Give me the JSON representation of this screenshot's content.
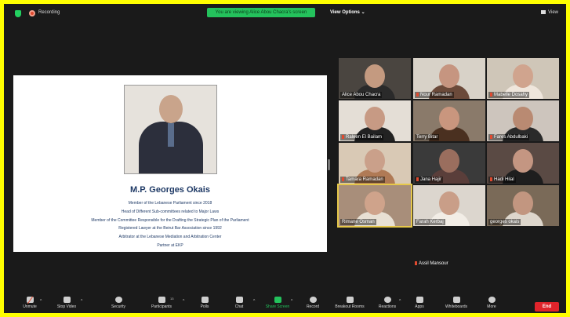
{
  "topbar": {
    "recording_label": "Recording",
    "viewing_banner": "You are viewing Alice Abou Chacra's screen",
    "view_options": "View Options ⌄",
    "view_label": "View"
  },
  "slide": {
    "title": "M.P. Georges Okais",
    "lines": [
      "Member of the Lebanese Parliament since 2018",
      "Head of Different Sub-committees related to Major Laws",
      "Member of the Committee Responsible for the Drafting the Strategic Plan of the Parliament",
      "Registered Lawyer at the Beirut Bar Association since 1992",
      "Arbitrator at the Lebanese Mediation and Arbitration Center",
      "Partner at EKP"
    ]
  },
  "participants": [
    {
      "name": "Alice Abou Chacra",
      "muted": false
    },
    {
      "name": "Nour Ramadan",
      "muted": true
    },
    {
      "name": "Mabelle Dosahy",
      "muted": true
    },
    {
      "name": "Raleen El Bailam",
      "muted": true
    },
    {
      "name": "Terry Bitar",
      "muted": false
    },
    {
      "name": "Fares Abdulbaki",
      "muted": true
    },
    {
      "name": "Tamara Ramadan",
      "muted": true
    },
    {
      "name": "Jana Hajir",
      "muted": true
    },
    {
      "name": "Hadi Hilal",
      "muted": true
    },
    {
      "name": "Rimane Osman",
      "muted": false
    },
    {
      "name": "Farah Kerbaj",
      "muted": false
    },
    {
      "name": "georges okais",
      "muted": false
    },
    {
      "name": "Assil Mansour",
      "muted": true
    }
  ],
  "toolbar": {
    "unmute": "Unmute",
    "stop_video": "Stop Video",
    "security": "Security",
    "participants": "Participants",
    "participants_count": "13",
    "polls": "Polls",
    "chat": "Chat",
    "share_screen": "Share Screen",
    "record": "Record",
    "breakout_rooms": "Breakout Rooms",
    "reactions": "Reactions",
    "apps": "Apps",
    "whiteboards": "Whiteboards",
    "more": "More",
    "end": "End"
  },
  "colors": {
    "accent_green": "#24c25c",
    "end_red": "#e0242b",
    "border_yellow": "#ffff00",
    "slide_text": "#1f3a66"
  }
}
